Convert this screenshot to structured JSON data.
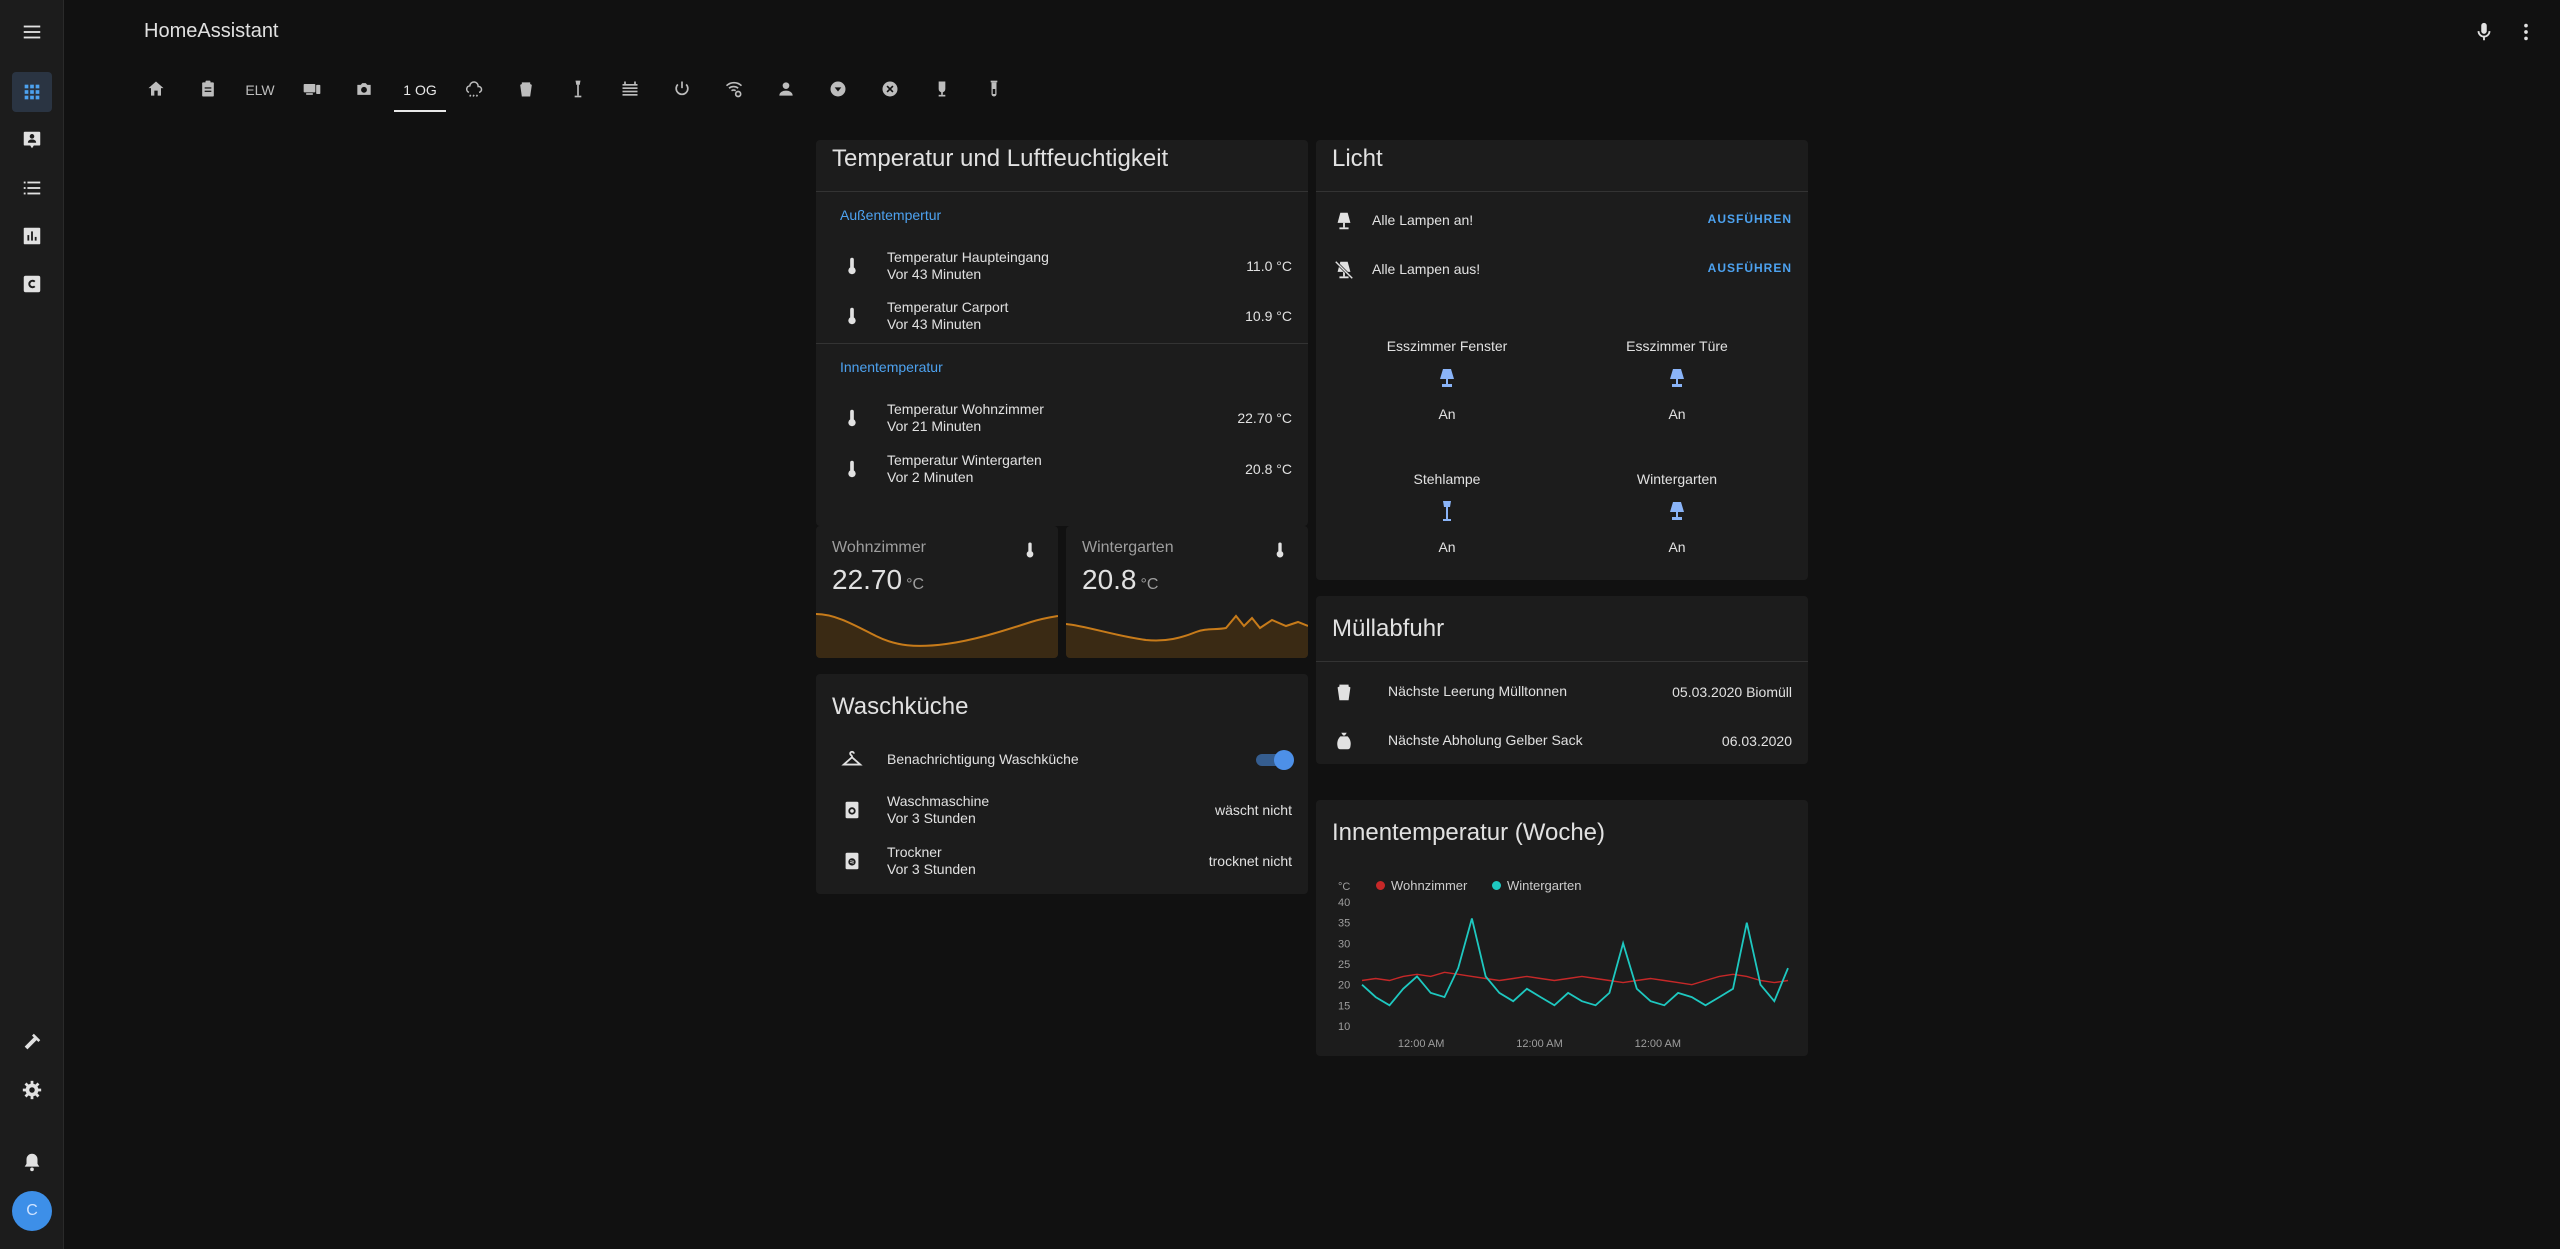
{
  "app": {
    "title": "HomeAssistant"
  },
  "sidebar": {
    "avatar_initial": "C"
  },
  "tabs": [
    "home",
    "clipboard",
    "ELW",
    "devices",
    "camera",
    "1 OG",
    "weather",
    "trash",
    "lamp",
    "heater",
    "power",
    "wifi",
    "person",
    "shield",
    "close",
    "wine",
    "tube"
  ],
  "tab_labels": {
    "elw": "ELW",
    "og1": "1 OG"
  },
  "temp_card": {
    "title": "Temperatur und Luftfeuchtigkeit",
    "section_outdoor": "Außentempertur",
    "section_indoor": "Innentemperatur",
    "rows": [
      {
        "name": "Temperatur Haupteingang",
        "sub": "Vor 43 Minuten",
        "value": "11.0 °C"
      },
      {
        "name": "Temperatur Carport",
        "sub": "Vor 43 Minuten",
        "value": "10.9 °C"
      },
      {
        "name": "Temperatur Wohnzimmer",
        "sub": "Vor 21 Minuten",
        "value": "22.70 °C"
      },
      {
        "name": "Temperatur Wintergarten",
        "sub": "Vor 2 Minuten",
        "value": "20.8 °C"
      }
    ]
  },
  "sensors": [
    {
      "name": "Wohnzimmer",
      "value": "22.70",
      "unit": "°C"
    },
    {
      "name": "Wintergarten",
      "value": "20.8",
      "unit": "°C"
    }
  ],
  "laundry": {
    "title": "Waschküche",
    "rows": [
      {
        "name": "Benachrichtigung Waschküche",
        "toggle": true
      },
      {
        "name": "Waschmaschine",
        "sub": "Vor 3 Stunden",
        "value": "wäscht nicht"
      },
      {
        "name": "Trockner",
        "sub": "Vor 3 Stunden",
        "value": "trocknet nicht"
      }
    ]
  },
  "light_card": {
    "title": "Licht",
    "scripts": [
      {
        "name": "Alle Lampen an!",
        "action": "AUSFÜHREN"
      },
      {
        "name": "Alle Lampen aus!",
        "action": "AUSFÜHREN"
      }
    ],
    "lights": [
      {
        "name": "Esszimmer Fenster",
        "state": "An"
      },
      {
        "name": "Esszimmer Türe",
        "state": "An"
      },
      {
        "name": "Stehlampe",
        "state": "An"
      },
      {
        "name": "Wintergarten",
        "state": "An"
      }
    ]
  },
  "trash": {
    "title": "Müllabfuhr",
    "rows": [
      {
        "name": "Nächste Leerung Mülltonnen",
        "value": "05.03.2020 Biomüll"
      },
      {
        "name": "Nächste Abholung Gelber Sack",
        "value": "06.03.2020"
      }
    ]
  },
  "history": {
    "title": "Innentemperatur (Woche)"
  },
  "colors": {
    "accent": "#4da2f0",
    "line_red": "#c62828",
    "line_teal": "#1ec8c0",
    "sparkline": "#c77b1a"
  },
  "chart_data": {
    "type": "line",
    "ylabel": "°C",
    "ylim": [
      10,
      40
    ],
    "yticks": [
      10,
      15,
      20,
      25,
      30,
      35,
      40
    ],
    "xticks": [
      "12:00 AM",
      "12:00 AM",
      "12:00 AM"
    ],
    "series": [
      {
        "name": "Wohnzimmer",
        "values": [
          21,
          21.5,
          21,
          22,
          22.5,
          22,
          23,
          22.5,
          22,
          21.5,
          21,
          21.5,
          22,
          21.5,
          21,
          21.5,
          22,
          21.5,
          21,
          20.5,
          21,
          21.5,
          21,
          20.5,
          20,
          21,
          22,
          22.5,
          22,
          21,
          20.5,
          21
        ]
      },
      {
        "name": "Wintergarten",
        "values": [
          20,
          17,
          15,
          19,
          22,
          18,
          17,
          24,
          36,
          22,
          18,
          16,
          19,
          17,
          15,
          18,
          16,
          15,
          18,
          30,
          19,
          16,
          15,
          18,
          17,
          15,
          17,
          19,
          35,
          20,
          16,
          24
        ]
      }
    ]
  }
}
